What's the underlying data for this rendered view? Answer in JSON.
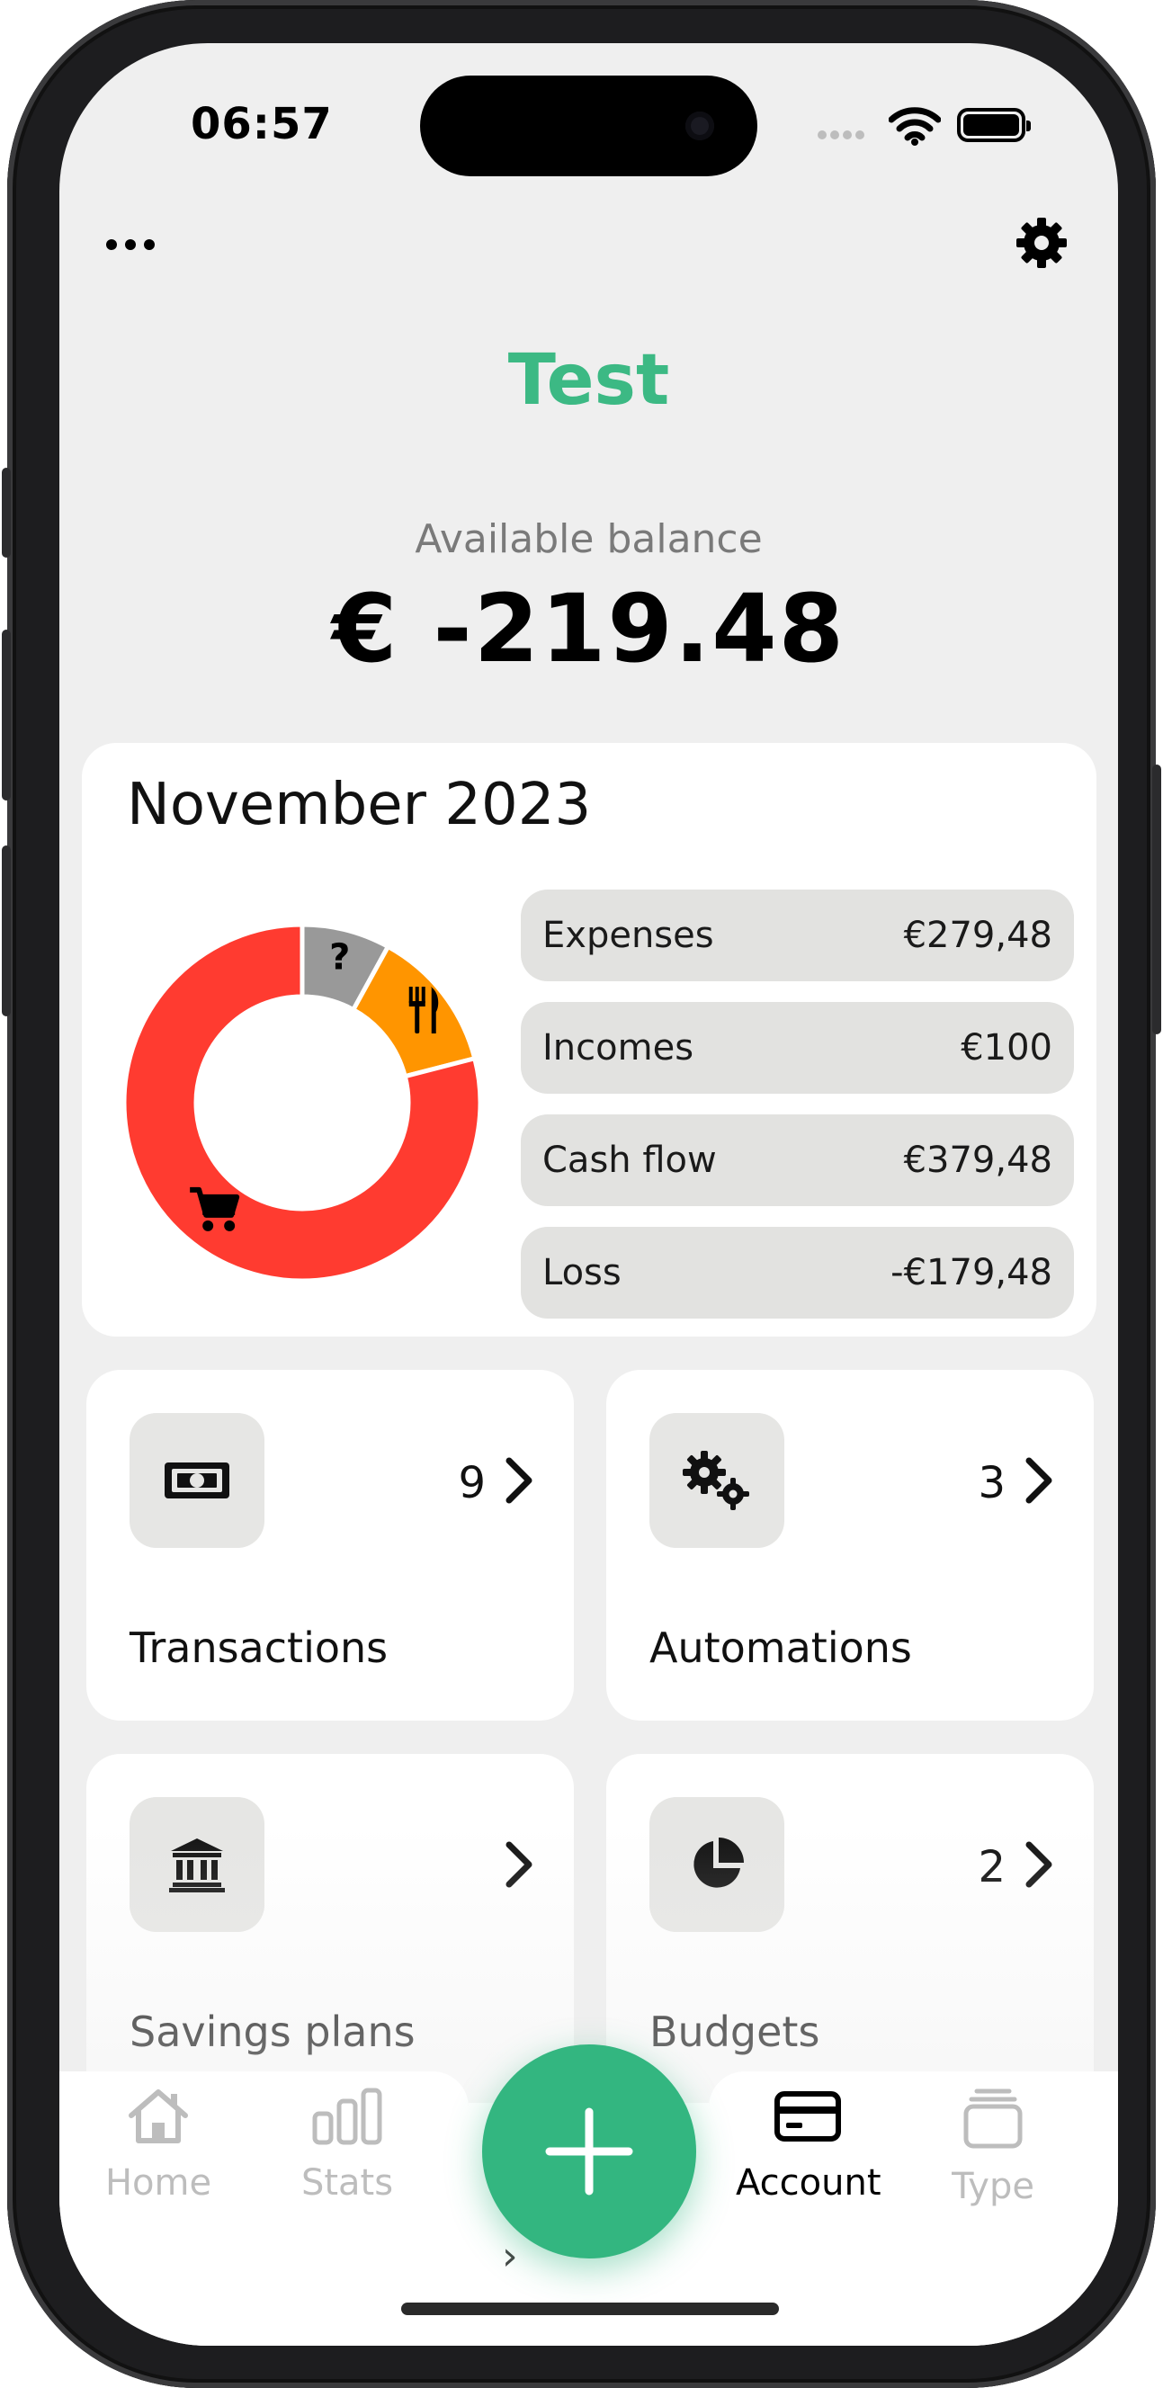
{
  "status_bar": {
    "time": "06:57"
  },
  "header": {
    "title": "Test"
  },
  "balance": {
    "label": "Available balance",
    "value": "€ -219.48"
  },
  "month_card": {
    "title": "November 2023",
    "stats": [
      {
        "label": "Expenses",
        "value": "€279,48"
      },
      {
        "label": "Incomes",
        "value": "€100"
      },
      {
        "label": "Cash flow",
        "value": "€379,48"
      },
      {
        "label": "Loss",
        "value": "-€179,48"
      }
    ],
    "chart_data": {
      "type": "pie",
      "slices": [
        {
          "category": "unknown",
          "icon": "question-mark-icon",
          "color": "#999999",
          "fraction": 0.08
        },
        {
          "category": "food",
          "icon": "fork-knife-icon",
          "color": "#ff9500",
          "fraction": 0.13
        },
        {
          "category": "shopping",
          "icon": "cart-icon",
          "color": "#ff3b30",
          "fraction": 0.79
        }
      ]
    }
  },
  "tiles": {
    "transactions": {
      "label": "Transactions",
      "count": "9",
      "icon": "banknote-icon"
    },
    "automations": {
      "label": "Automations",
      "count": "3",
      "icon": "gears-icon"
    },
    "savings": {
      "label": "Savings plans",
      "count": "",
      "icon": "bank-icon"
    },
    "budgets": {
      "label": "Budgets",
      "count": "2",
      "icon": "pie-chart-icon"
    }
  },
  "tabbar": {
    "home": "Home",
    "stats": "Stats",
    "account": "Account",
    "type": "Type",
    "active": "Account"
  },
  "colors": {
    "accent": "#3cb984",
    "fab": "#33b680",
    "expense_red": "#ff3b30",
    "food_orange": "#ff9500",
    "unknown_gray": "#999999"
  }
}
